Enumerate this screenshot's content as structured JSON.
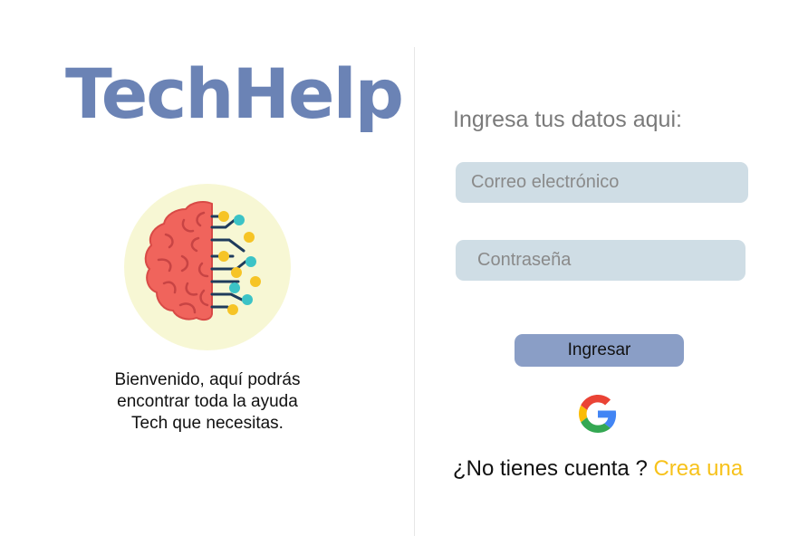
{
  "brand": {
    "title": "TechHelp",
    "welcome_lines": [
      "Bienvenido, aquí podrás",
      "encontrar toda la ayuda",
      "Tech que necesitas."
    ]
  },
  "form": {
    "heading": "Ingresa tus datos aqui:",
    "email_placeholder": "Correo electrónico",
    "password_placeholder": "Contraseña",
    "submit_label": "Ingresar",
    "google_icon": "google-g-icon",
    "signup_prompt": "¿No tienes cuenta ? ",
    "signup_link": "Crea una"
  },
  "colors": {
    "brand_title": "#6b83b5",
    "input_bg": "#cfdde5",
    "button_bg": "#8a9ec6",
    "link": "#f7c21b",
    "logo_bg": "#f7f7d4",
    "brain": "#f0645c"
  }
}
